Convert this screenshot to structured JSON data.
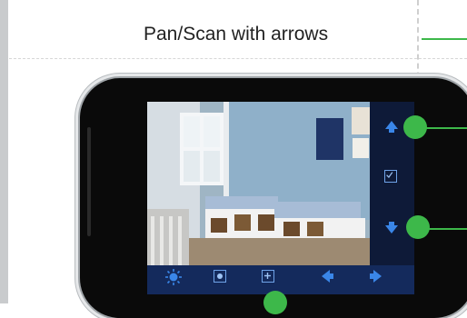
{
  "caption": "Pan/Scan with arrows",
  "colors": {
    "accent_green": "#3db84a",
    "screen_bg": "#142a5c",
    "icon_blue": "#3a86e8"
  },
  "icons": {
    "side": [
      "arrow-up-icon",
      "checkbox-icon",
      "arrow-down-icon"
    ],
    "bottom": [
      "brightness-icon",
      "record-icon",
      "zoom-icon",
      "arrow-left-icon",
      "arrow-right-icon"
    ]
  }
}
